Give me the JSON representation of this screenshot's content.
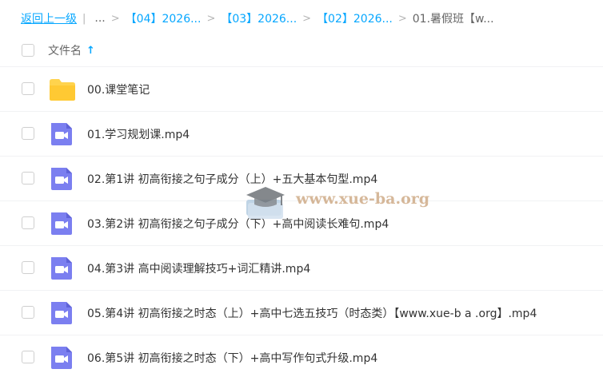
{
  "breadcrumb": {
    "back_label": "返回上一级",
    "divider": "|",
    "ellipsis": "...",
    "items": [
      "【04】2026...",
      "【03】2026...",
      "【02】2026..."
    ],
    "current": "01.暑假班【w...",
    "separator": ">"
  },
  "list_header": {
    "name_label": "文件名",
    "sort_icon": "arrow-up-icon"
  },
  "files": [
    {
      "name": "00.课堂笔记",
      "type": "folder"
    },
    {
      "name": "01.学习规划课.mp4",
      "type": "video"
    },
    {
      "name": "02.第1讲 初高衔接之句子成分（上）+五大基本句型.mp4",
      "type": "video"
    },
    {
      "name": "03.第2讲 初高衔接之句子成分（下）+高中阅读长难句.mp4",
      "type": "video"
    },
    {
      "name": "04.第3讲 高中阅读理解技巧+词汇精讲.mp4",
      "type": "video"
    },
    {
      "name": "05.第4讲 初高衔接之时态（上）+高中七选五技巧（时态类）【www.xue-b a .org】.mp4",
      "type": "video"
    },
    {
      "name": "06.第5讲 初高衔接之时态（下）+高中写作句式升级.mp4",
      "type": "video"
    }
  ],
  "watermark": {
    "text": "www.xue-ba.org"
  },
  "colors": {
    "accent": "#06a7ff",
    "folder": "#ffd34d",
    "video": "#7b7ff0"
  }
}
